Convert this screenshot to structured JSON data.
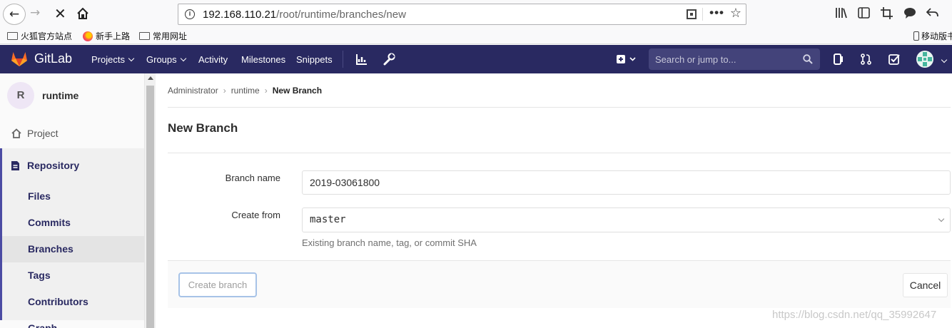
{
  "browser": {
    "url_host": "192.168.110.21",
    "url_path": "/root/runtime/branches/new",
    "bookmarks": [
      "火狐官方站点",
      "新手上路",
      "常用网址"
    ],
    "mobile_bookmark": "移动版书"
  },
  "header": {
    "brand": "GitLab",
    "nav": [
      "Projects",
      "Groups",
      "Activity",
      "Milestones",
      "Snippets"
    ],
    "search_placeholder": "Search or jump to..."
  },
  "sidebar": {
    "project_initial": "R",
    "project_name": "runtime",
    "project_label": "Project",
    "repository_label": "Repository",
    "items": [
      "Files",
      "Commits",
      "Branches",
      "Tags",
      "Contributors",
      "Graph"
    ],
    "active_item": "Branches"
  },
  "breadcrumb": [
    "Administrator",
    "runtime",
    "New Branch"
  ],
  "page": {
    "title": "New Branch",
    "branch_name_label": "Branch name",
    "branch_name_value": "2019-03061800",
    "create_from_label": "Create from",
    "create_from_value": "master",
    "help_text": "Existing branch name, tag, or commit SHA",
    "create_button": "Create branch",
    "cancel_button": "Cancel"
  },
  "watermark": "https://blog.csdn.net/qq_35992647",
  "colors": {
    "header_bg": "#292961",
    "search_bg": "#43437a",
    "sidebar_active_border": "#4b4ba3",
    "create_button_border": "#a7c3e7"
  }
}
